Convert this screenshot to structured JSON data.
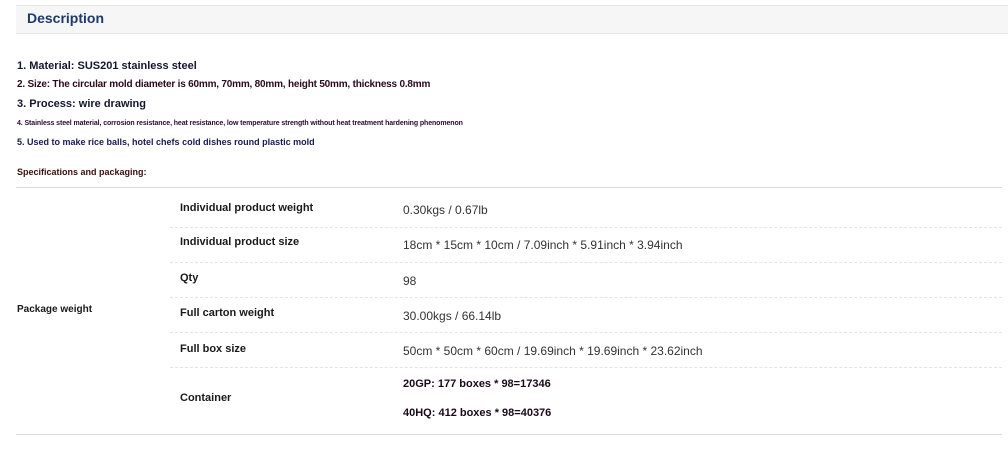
{
  "header": {
    "title": "Description"
  },
  "points": [
    "1. Material: SUS201 stainless steel",
    "2. Size: The circular mold diameter is 60mm, 70mm, 80mm, height 50mm, thickness 0.8mm",
    "3. Process: wire drawing",
    "4. Stainless steel material, corrosion resistance, heat resistance, low temperature strength without heat treatment hardening phenomenon",
    "5. Used to make rice balls, hotel chefs cold dishes round plastic mold"
  ],
  "specs": {
    "title": "Specifications and packaging:",
    "group_label": "Package weight",
    "rows": [
      {
        "label": "Individual product weight",
        "value": "0.30kgs / 0.67lb"
      },
      {
        "label": "Individual product size",
        "value": "18cm * 15cm * 10cm / 7.09inch * 5.91inch * 3.94inch"
      },
      {
        "label": "Qty",
        "value": "98"
      },
      {
        "label": "Full carton weight",
        "value": "30.00kgs / 66.14lb"
      },
      {
        "label": "Full box size",
        "value": "50cm * 50cm * 60cm / 19.69inch * 19.69inch * 23.62inch"
      },
      {
        "label": "Container",
        "values": [
          "20GP: 177 boxes * 98=17346",
          "40HQ: 412 boxes * 98=40376"
        ]
      }
    ]
  }
}
